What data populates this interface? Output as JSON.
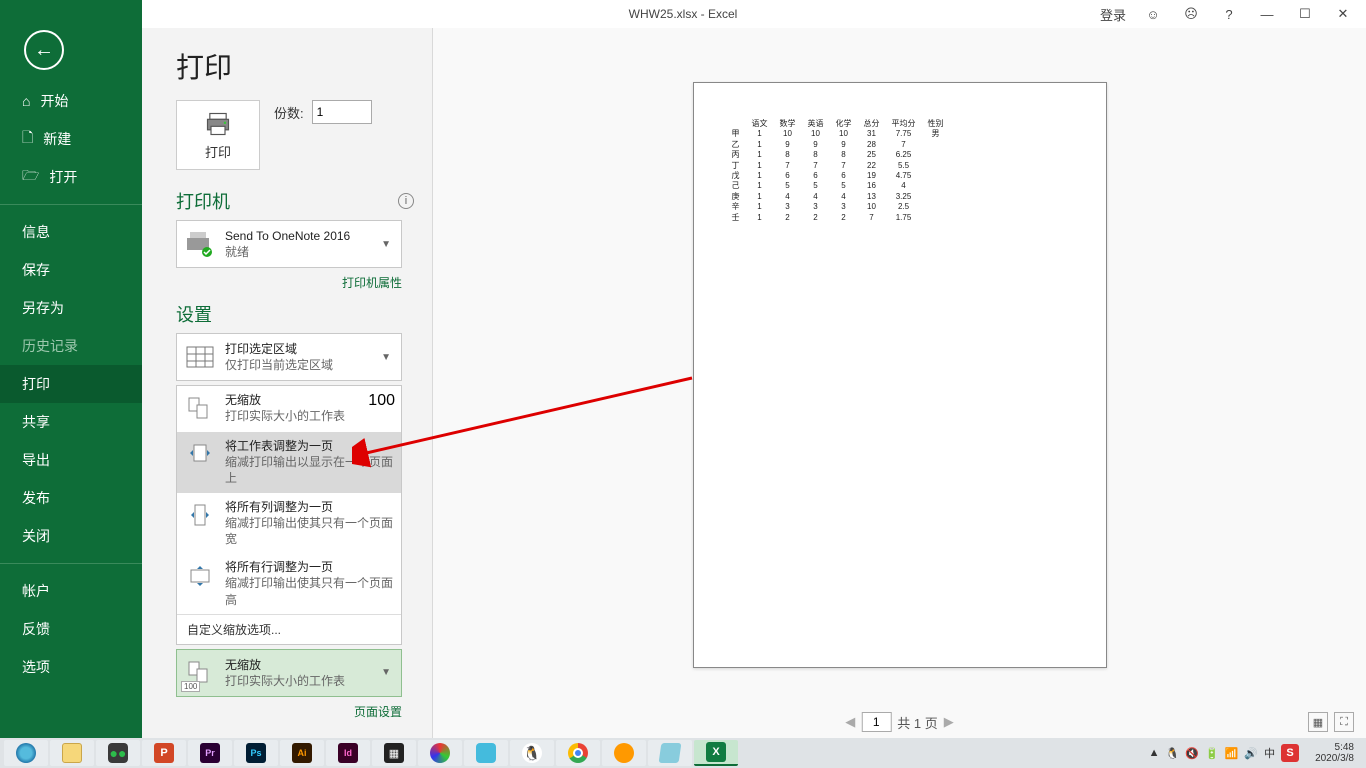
{
  "titlebar": {
    "filename": "WHW25.xlsx",
    "sep": "  -  ",
    "app": "Excel",
    "login": "登录",
    "smile": "☺",
    "frown": "☹",
    "help": "?",
    "min": "—",
    "max": "☐",
    "close": "✕"
  },
  "sidebar": {
    "home": "开始",
    "new": "新建",
    "open": "打开",
    "info": "信息",
    "save": "保存",
    "saveas": "另存为",
    "history": "历史记录",
    "print": "打印",
    "share": "共享",
    "export": "导出",
    "publish": "发布",
    "close": "关闭",
    "account": "帐户",
    "feedback": "反馈",
    "options": "选项"
  },
  "print": {
    "title": "打印",
    "button": "打印",
    "copies_label": "份数:",
    "copies_value": "1",
    "printer_heading": "打印机",
    "printer_name": "Send To OneNote 2016",
    "printer_status": "就绪",
    "printer_props": "打印机属性",
    "settings_heading": "设置",
    "area_title": "打印选定区域",
    "area_sub": "仅打印当前选定区域",
    "scale_items": [
      {
        "t1": "无缩放",
        "t2": "打印实际大小的工作表",
        "badge": "100"
      },
      {
        "t1": "将工作表调整为一页",
        "t2": "缩减打印输出以显示在一个页面上"
      },
      {
        "t1": "将所有列调整为一页",
        "t2": "缩减打印输出使其只有一个页面宽"
      },
      {
        "t1": "将所有行调整为一页",
        "t2": "缩减打印输出使其只有一个页面高"
      }
    ],
    "scale_custom": "自定义缩放选项...",
    "scale_current_t1": "无缩放",
    "scale_current_t2": "打印实际大小的工作表",
    "page_setup": "页面设置"
  },
  "pager": {
    "page": "1",
    "of_prefix": "共 ",
    "of_count": "1",
    "of_suffix": " 页"
  },
  "chart_data": {
    "type": "table",
    "columns": [
      "",
      "语文",
      "数学",
      "英语",
      "化学",
      "总分",
      "平均分",
      "性别"
    ],
    "rows": [
      [
        "甲",
        "1",
        "10",
        "10",
        "10",
        "31",
        "7.75",
        "男"
      ],
      [
        "乙",
        "1",
        "9",
        "9",
        "9",
        "28",
        "7",
        ""
      ],
      [
        "丙",
        "1",
        "8",
        "8",
        "8",
        "25",
        "6.25",
        ""
      ],
      [
        "丁",
        "1",
        "7",
        "7",
        "7",
        "22",
        "5.5",
        ""
      ],
      [
        "戊",
        "1",
        "6",
        "6",
        "6",
        "19",
        "4.75",
        ""
      ],
      [
        "己",
        "1",
        "5",
        "5",
        "5",
        "16",
        "4",
        ""
      ],
      [
        "庚",
        "1",
        "4",
        "4",
        "4",
        "13",
        "3.25",
        ""
      ],
      [
        "辛",
        "1",
        "3",
        "3",
        "3",
        "10",
        "2.5",
        ""
      ],
      [
        "壬",
        "1",
        "2",
        "2",
        "2",
        "7",
        "1.75",
        ""
      ]
    ]
  },
  "taskbar": {
    "tray": [
      "▲",
      "🐧",
      "🔇",
      "🔋",
      "📶",
      "🔊",
      "中"
    ],
    "time": "5:48",
    "date": "2020/3/8"
  }
}
